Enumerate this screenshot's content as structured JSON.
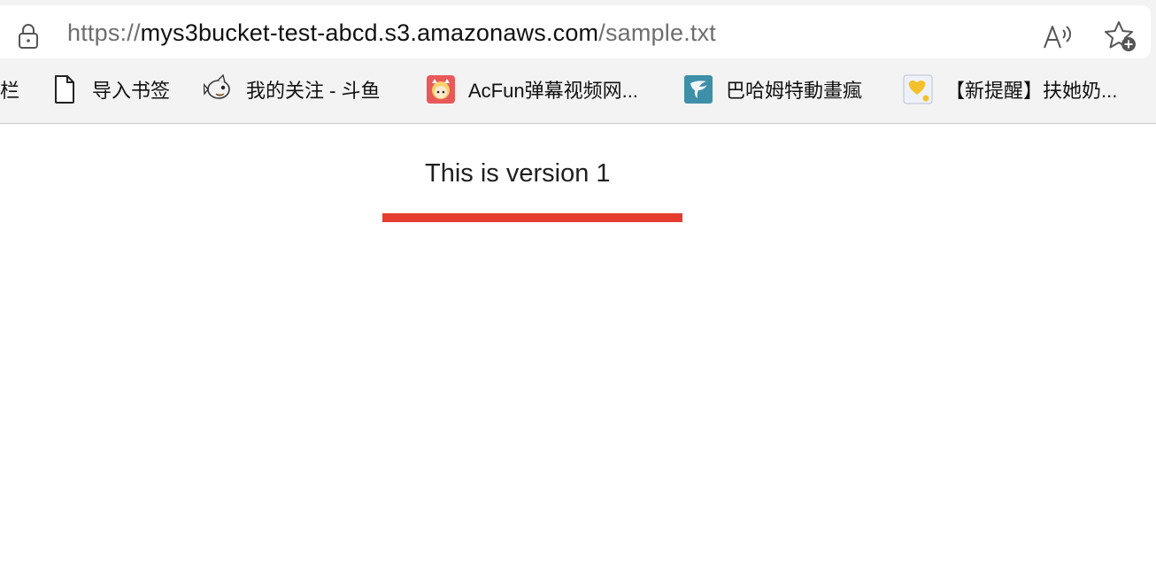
{
  "address_bar": {
    "url_scheme": "https://",
    "url_host": "mys3bucket-test-abcd.s3.amazonaws.com",
    "url_path": "/sample.txt"
  },
  "bookmarks_bar": {
    "items": [
      {
        "label": "栏",
        "icon": "none"
      },
      {
        "label": "导入书签",
        "icon": "document-icon"
      },
      {
        "label": "我的关注 - 斗鱼",
        "icon": "douyu-fish-icon"
      },
      {
        "label": "AcFun弹幕视频网...",
        "icon": "acfun-icon"
      },
      {
        "label": "巴哈姆特動畫瘋",
        "icon": "bahamut-icon"
      },
      {
        "label": "【新提醒】扶她奶...",
        "icon": "yellow-heart-site-icon"
      }
    ]
  },
  "page": {
    "text": "This is version 1"
  },
  "colors": {
    "accent_bar": "#e43d2f",
    "acfun": "#e85a5a",
    "bahamut": "#3e8fa8"
  }
}
